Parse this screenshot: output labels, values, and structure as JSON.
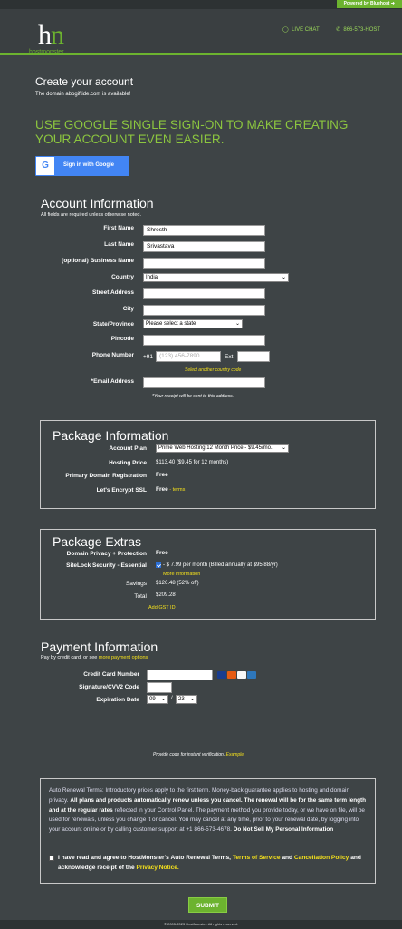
{
  "topbar": {
    "powered_by": "Powered by Bluehost ➜"
  },
  "header": {
    "logo_brand_host": "host",
    "logo_brand_monster": "monster",
    "live_chat": "LIVE CHAT",
    "phone": "866-573-HOST",
    "icons": [
      "chat-icon",
      "phone-icon"
    ]
  },
  "page": {
    "title": "Create your account",
    "domain_message": "The domain abogiftide.com is available!",
    "google_heading": "USE GOOGLE SINGLE SIGN-ON TO MAKE CREATING YOUR ACCOUNT EVEN EASIER.",
    "google_button": "Sign in with Google"
  },
  "account": {
    "title": "Account Information",
    "subtitle": "All fields are required unless otherwise noted.",
    "first_name_label": "First Name",
    "first_name_value": "Shresth",
    "last_name_label": "Last Name",
    "last_name_value": "Srivastava",
    "business_label": "(optional) Business Name",
    "country_label": "Country",
    "country_value": "India",
    "street_label": "Street Address",
    "city_label": "City",
    "state_label": "State/Province",
    "state_value": "Please select a state",
    "pincode_label": "Pincode",
    "phone_label": "Phone Number",
    "phone_code": "+91",
    "phone_placeholder": "(123) 456-7890",
    "ext_label": "Ext",
    "country_code_link": "Select another country code",
    "email_label": "*Email Address",
    "email_note": "*Your receipt will be sent to this address."
  },
  "package": {
    "title": "Package Information",
    "plan_label": "Account Plan",
    "plan_value": "Prime Web Hosting 12 Month Price - $9.45/mo.",
    "hosting_price_label": "Hosting Price",
    "hosting_price_value": "$113.40   ($9.45 for 12 months)",
    "domain_reg_label": "Primary Domain Registration",
    "domain_reg_value": "Free",
    "ssl_label": "Let's Encrypt SSL",
    "ssl_value": "Free",
    "ssl_terms": " - terms"
  },
  "extras": {
    "title": "Package Extras",
    "privacy_label": "Domain Privacy + Protection",
    "privacy_value": "Free",
    "sitelock_label": "SiteLock Security - Essential",
    "sitelock_value": "- $ 7.99 per month (Billed annually at $95.88/yr)",
    "sitelock_more": "More information",
    "savings_label": "Savings",
    "savings_value": "$126.48 (52% off)",
    "total_label": "Total",
    "total_value": "$209.28",
    "gst_link": "Add GST ID"
  },
  "payment": {
    "title": "Payment Information",
    "subtitle_prefix": "Pay by credit card, or see ",
    "subtitle_link": "more payment options",
    "cc_label": "Credit Card Number",
    "cvv_label": "Signature/CVV2 Code",
    "exp_label": "Expiration Date",
    "exp_month": "09",
    "exp_sep": "/",
    "exp_year": "23",
    "verify_note": "Provide code for instant verification. ",
    "verify_example": "Example."
  },
  "renewal": {
    "p1": "Auto Renewal Terms: Introductory prices apply to the first term. Money-back guarantee applies to hosting and domain privacy. ",
    "p2": "All plans and products automatically renew unless you cancel. The renewal will be for the same term length and at the ",
    "p3": "regular rates",
    "p4": " reflected in your Control Panel. The payment method you provide today, or we have on file, will be used for renewals, unless you change it or cancel. You may cancel at any time, prior to your renewal date, by logging into your account online or by calling customer support at +1 866-573-4678. ",
    "p5": "Do Not Sell My Personal Information",
    "agree1": "I have read and agree to HostMonster's Auto Renewal Terms, ",
    "agree_tos": "Terms of Service",
    "agree2": " and ",
    "agree_cancel": "Cancellation Policy",
    "agree3": " and acknowledge receipt of the ",
    "agree_privacy": "Privacy Notice."
  },
  "submit": "SUBMIT",
  "footer": "© 2005-2023 HostMonster. All rights reserved.",
  "colors": {
    "accent": "#6cb32f",
    "heading_green": "#8cc63f",
    "link_yellow": "#f4e01c",
    "background": "#3e4446"
  }
}
